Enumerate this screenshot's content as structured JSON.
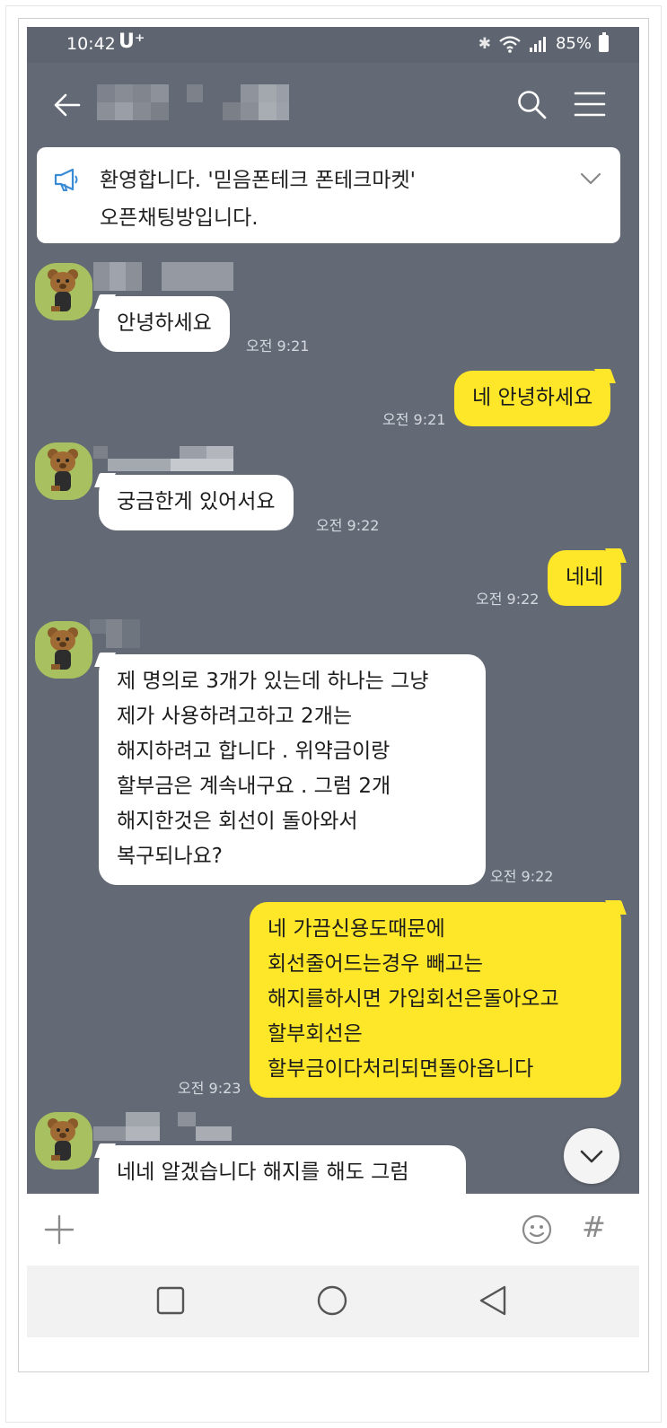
{
  "status_bar": {
    "time": "10:42",
    "carrier": "U⁺",
    "battery": "85%"
  },
  "header": {
    "back_icon": "arrow-left-icon",
    "search_icon": "search-icon",
    "menu_icon": "hamburger-menu-icon"
  },
  "notice": {
    "icon": "megaphone-icon",
    "line1": "환영합니다. '믿음폰테크 폰테크마켓'",
    "line2": "오픈채팅방입니다."
  },
  "messages": [
    {
      "side": "in",
      "lines": [
        "안녕하세요"
      ],
      "time": "오전 9:21"
    },
    {
      "side": "out",
      "lines": [
        "네 안녕하세요"
      ],
      "time": "오전 9:21"
    },
    {
      "side": "in",
      "lines": [
        "궁금한게 있어서요"
      ],
      "time": "오전 9:22"
    },
    {
      "side": "out",
      "lines": [
        "네네"
      ],
      "time": "오전 9:22"
    },
    {
      "side": "in",
      "lines": [
        "제 명의로 3개가 있는데 하나는 그냥",
        "제가 사용하려고하고 2개는",
        "해지하려고 합니다 . 위약금이랑",
        "할부금은 계속내구요 . 그럼 2개",
        "해지한것은 회선이 돌아와서",
        "복구되나요?"
      ],
      "time": "오전 9:22"
    },
    {
      "side": "out",
      "lines": [
        "네 가끔신용도때문에",
        "회선줄어드는경우 빼고는",
        "해지를하시면 가입회선은돌아오고",
        "할부회선은",
        "할부금이다처리되면돌아옵니다"
      ],
      "time": "오전 9:23"
    },
    {
      "side": "in",
      "lines": [
        "네네 알겠습니다 해지를 해도 그럼"
      ],
      "time": ""
    }
  ],
  "input_bar": {
    "placeholder": "",
    "plus_icon": "plus-icon",
    "emoji_icon": "emoji-icon",
    "hash_label": "#"
  },
  "nav_bar": {
    "recent_icon": "square-icon",
    "home_icon": "circle-icon",
    "back_icon": "triangle-back-icon"
  },
  "colors": {
    "chat_background": "#646a75",
    "outgoing_bubble": "#fee629",
    "incoming_bubble": "#ffffff",
    "avatar_background": "#a8c060"
  }
}
